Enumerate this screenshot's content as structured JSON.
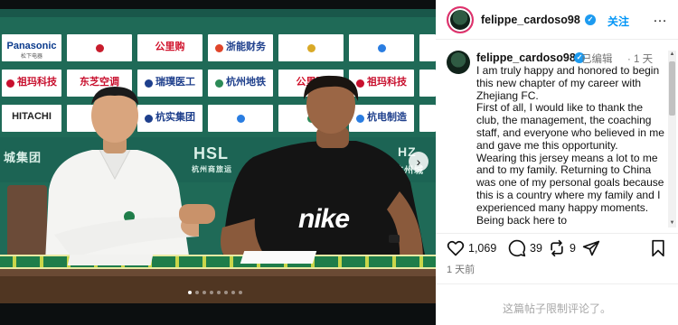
{
  "photo": {
    "sponsors": [
      "Panasonic",
      "松下电器",
      "",
      "公里购",
      "浙能财务",
      "",
      "",
      "祖玛科技",
      "东芝空调",
      "瑞璞医工",
      "杭州地铁",
      "公里购",
      "祖玛科技",
      "HITACHI",
      "",
      "杭实集团",
      "",
      "",
      "杭电制造"
    ],
    "banner_texts": [
      "城集团",
      "HSL",
      "杭州商旅运",
      "HZ",
      "杭州城"
    ],
    "jersey_text": "nike",
    "next_arrow": "›",
    "carousel_dots": 8,
    "active_dot": 0
  },
  "profile": {
    "username": "felippe_cardoso98",
    "verified_mark": "✓",
    "follow_label": "关注",
    "more_label": "…"
  },
  "post": {
    "username": "felippe_cardoso98",
    "edited_label": "已编辑",
    "time_ago": "· 1 天",
    "caption": "I am truly happy and honored to begin this new chapter of my career with Zhejiang FC.\nFirst of all, I would like to thank the club, the management, the coaching staff, and everyone who believed in me and gave me this opportunity.\nWearing this jersey means a lot to me and to my family. Returning to China was one of my personal goals because this is a country where my family and I experienced many happy moments. Being back here to"
  },
  "actions": {
    "likes": "1,069",
    "comments": "39",
    "reposts": "9"
  },
  "footer": {
    "date_label": "1 天前",
    "restricted_label": "这篇帖子限制评论了。"
  },
  "icons": {
    "like": "heart-icon",
    "comment": "comment-bubble-icon",
    "repost": "repost-icon",
    "share": "share-paper-plane-icon",
    "save": "bookmark-icon",
    "more": "more-dots-icon",
    "next": "chevron-right-icon"
  }
}
